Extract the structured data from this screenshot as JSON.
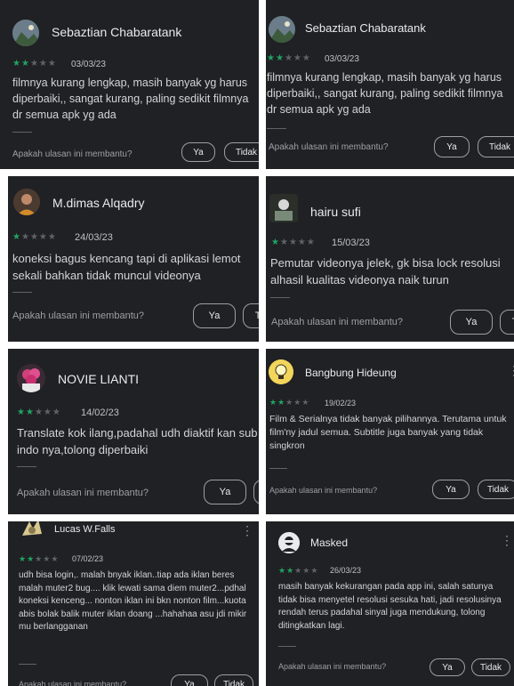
{
  "help_text": "Apakah ulasan ini membantu?",
  "yes_label": "Ya",
  "no_label": "Tidak",
  "colors": {
    "card_bg": "#202124",
    "star_filled": "#1fa463",
    "star_empty": "#5f6368"
  },
  "reviews": [
    {
      "author": "Sebaztian Chabaratank",
      "rating": 2,
      "date": "03/03/23",
      "text": "filmnya kurang lengkap, masih banyak yg harus diperbaiki,, sangat kurang, paling sedikit filmnya dr semua apk yg ada",
      "avatar_icon": "landscape-avatar-icon"
    },
    {
      "author": "Sebaztian Chabaratank",
      "rating": 2,
      "date": "03/03/23",
      "text": "filmnya kurang lengkap, masih banyak yg harus diperbaiki,, sangat kurang, paling sedikit filmnya dr semua apk yg ada",
      "avatar_icon": "landscape-avatar-icon"
    },
    {
      "author": "M.dimas Alqadry",
      "rating": 1,
      "date": "24/03/23",
      "text": "koneksi bagus kencang tapi di aplikasi lemot sekali bahkan tidak muncul videonya",
      "avatar_icon": "person-avatar-icon"
    },
    {
      "author": "hairu sufi",
      "rating": 1,
      "date": "15/03/23",
      "text": "Pemutar videonya jelek, gk bisa lock resolusi alhasil kualitas videonya naik turun",
      "avatar_icon": "photo-avatar-icon"
    },
    {
      "author": "NOVIE LIANTI",
      "rating": 2,
      "date": "14/02/23",
      "text": "Translate kok ilang,padahal udh diaktif kan sub indo nya,tolong diperbaiki",
      "avatar_icon": "flower-avatar-icon"
    },
    {
      "author": "Bangbung Hideung",
      "rating": 2,
      "date": "19/02/23",
      "text": "Film & Serialnya tidak banyak pilihannya. Terutama untuk film'ny jadul semua. Subtitle juga banyak yang tidak singkron",
      "avatar_icon": "lightbulb-avatar-icon"
    },
    {
      "author": "Lucas W.Falls",
      "rating": 2,
      "date": "07/02/23",
      "text": "udh bisa login,. malah bnyak iklan..tiap ada iklan beres malah muter2 bug.... klik lewati sama diem muter2...pdhal koneksi kenceng... nonton iklan ini bkn nonton film...kuota abis bolak balik muter iklan doang ...hahahaa asu jdi mikir mu berlangganan",
      "avatar_icon": "character-avatar-icon"
    },
    {
      "author": "Masked",
      "rating": 2,
      "date": "26/03/23",
      "text": "masih banyak kekurangan pada app ini, salah satunya tidak bisa menyetel resolusi sesuka hati, jadi resolusinya rendah terus padahal sinyal juga mendukung, tolong ditingkatkan lagi.",
      "avatar_icon": "masked-avatar-icon"
    }
  ]
}
